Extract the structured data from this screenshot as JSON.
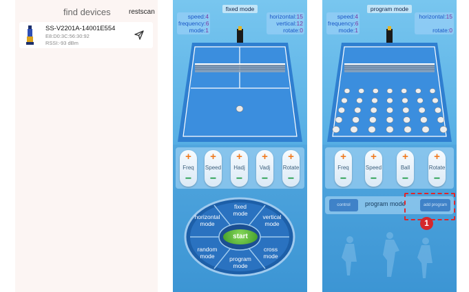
{
  "device_list": {
    "title": "find devices",
    "rescan_label": "restscan",
    "device": {
      "name": "SS-V2201A-14001E554",
      "mac": "E8:D0:3C:56:30:92",
      "rssi": "RSSI:-93 dBm"
    }
  },
  "fixed_panel": {
    "title": "fixed mode",
    "status_left": [
      {
        "label": "speed:",
        "value": "4"
      },
      {
        "label": "frequency:",
        "value": "6"
      },
      {
        "label": "mode:",
        "value": "1"
      }
    ],
    "status_right": [
      {
        "label": "horizontal:",
        "value": "15"
      },
      {
        "label": "vertical:",
        "value": "12"
      },
      {
        "label": "rotate:",
        "value": "0"
      }
    ],
    "adjust_buttons": [
      {
        "plus": "+",
        "label": "Freq",
        "minus": "−"
      },
      {
        "plus": "+",
        "label": "Speed",
        "minus": "−"
      },
      {
        "plus": "+",
        "label": "Hadj",
        "minus": "−"
      },
      {
        "plus": "+",
        "label": "Vadj",
        "minus": "−"
      },
      {
        "plus": "+",
        "label": "Rotate",
        "minus": "−"
      }
    ],
    "wheel": {
      "fixed_mode": [
        "fixed",
        "mode"
      ],
      "horizontal_mode": [
        "horizontal",
        "mode"
      ],
      "vertical_mode": [
        "vertical",
        "mode"
      ],
      "random_mode": [
        "random",
        "mode"
      ],
      "cross_mode": [
        "cross",
        "mode"
      ],
      "program_mode": [
        "program",
        "mode"
      ],
      "start_label": "start"
    }
  },
  "program_panel": {
    "title": "program mode",
    "status_left": [
      {
        "label": "speed:",
        "value": "4"
      },
      {
        "label": "frequency:",
        "value": "6"
      },
      {
        "label": "mode:",
        "value": "1"
      }
    ],
    "status_right": [
      {
        "label": "horizontal:",
        "value": "15"
      },
      {
        "label": "rotate:",
        "value": "0"
      }
    ],
    "adjust_buttons": [
      {
        "plus": "+",
        "label": "Freq",
        "minus": "−"
      },
      {
        "plus": "+",
        "label": "Speed",
        "minus": "−"
      },
      {
        "plus": "+",
        "label": "Ball",
        "minus": "−"
      },
      {
        "plus": "+",
        "label": "Rotate",
        "minus": "−"
      }
    ],
    "control_label": "control",
    "mode_label": "program mode",
    "add_program_label": "add program",
    "marker_number": "1"
  },
  "colors": {
    "panel_bg": "#3c95d4",
    "court_blue": "#2f7fd0",
    "plus_orange": "#f07a1e",
    "minus_green": "#1d9c46",
    "start_green": "#3f9a26",
    "highlight_red": "#e0262a"
  }
}
